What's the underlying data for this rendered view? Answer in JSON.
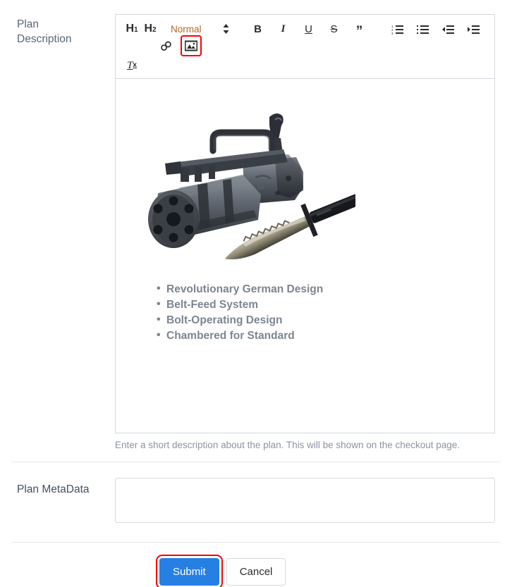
{
  "fields": {
    "description": {
      "label_line1": "Plan",
      "label_line2": "Description",
      "help_text": "Enter a short description about the plan. This will be shown on the checkout page."
    },
    "metadata": {
      "label": "Plan MetaData",
      "value": "",
      "placeholder": ""
    }
  },
  "editor": {
    "toolbar": {
      "heading1": "H",
      "heading1_sub": "1",
      "heading2": "H",
      "heading2_sub": "2",
      "format_picker_value": "Normal",
      "bold": "B",
      "italic": "I",
      "underline": "U",
      "strike": "S",
      "blockquote": "”",
      "ordered_list": "ordered-list-icon",
      "bullet_list": "bullet-list-icon",
      "outdent": "outdent-icon",
      "indent": "indent-icon",
      "link": "link-icon",
      "image": "image-icon",
      "clear_format": "T",
      "clear_format_sub": "x",
      "highlighted_button": "image-icon"
    },
    "content": {
      "image_alt": "Minigun with combat knife",
      "bullets": [
        "Revolutionary German Design",
        "Belt-Feed System",
        "Bolt-Operating Design",
        "Chambered for Standard"
      ]
    }
  },
  "actions": {
    "submit_label": "Submit",
    "cancel_label": "Cancel",
    "highlighted_button": "submit-button"
  },
  "colors": {
    "primary_button": "#2680e3",
    "highlight_outline": "#fb0007",
    "label_text": "#5a6678",
    "bullet_text": "#7c8591",
    "help_text": "#8d93a1",
    "picker_text": "#b06a28",
    "border": "#d5d8dc"
  }
}
